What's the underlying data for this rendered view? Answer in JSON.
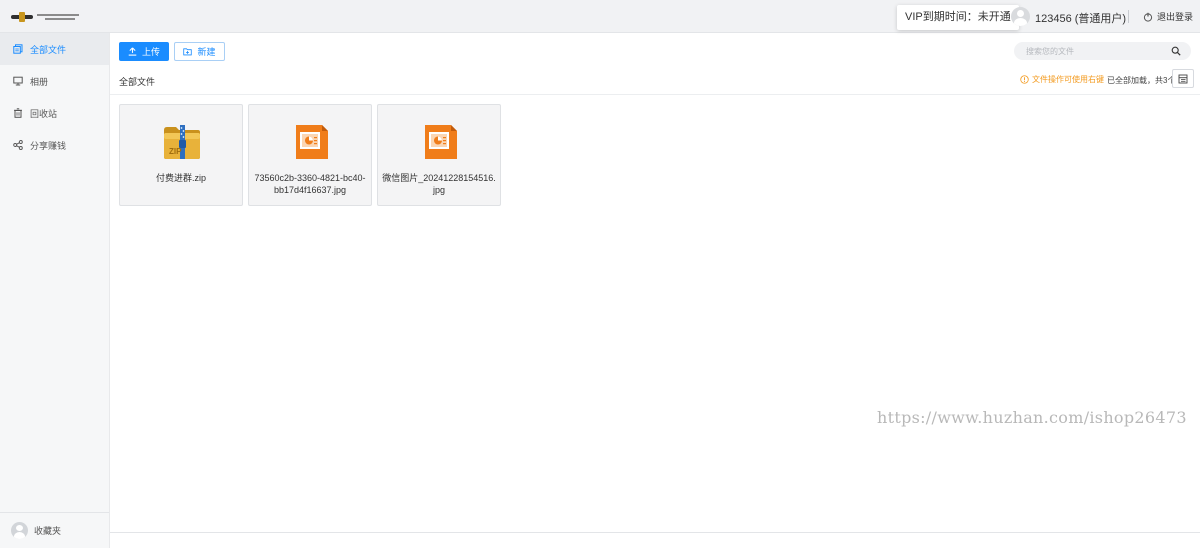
{
  "header": {
    "vip_tip": "VIP到期时间：未开通",
    "user_name": "123456 (普通用户)",
    "logout_label": "退出登录"
  },
  "sidebar": {
    "items": [
      {
        "label": "全部文件",
        "icon": "all-files-icon",
        "active": true
      },
      {
        "label": "相册",
        "icon": "monitor-icon",
        "active": false
      },
      {
        "label": "回收站",
        "icon": "trash-icon",
        "active": false
      },
      {
        "label": "分享赚钱",
        "icon": "share-icon",
        "active": false
      }
    ],
    "favorites_label": "收藏夹"
  },
  "toolbar": {
    "upload_label": "上传",
    "new_label": "新建",
    "search_placeholder": "搜索您的文件"
  },
  "main": {
    "breadcrumb": "全部文件",
    "tip": "文件操作可使用右键",
    "loaded_text": "已全部加载，共3个",
    "files": [
      {
        "name": "付费进群.zip",
        "icon": "zip-file-icon"
      },
      {
        "name": "73560c2b-3360-4821-bc40-bb17d4f16637.jpg",
        "icon": "image-file-icon"
      },
      {
        "name": "微信图片_20241228154516.jpg",
        "icon": "image-file-icon"
      }
    ]
  },
  "watermark": "https://www.huzhan.com/ishop26473",
  "colors": {
    "accent": "#1a8cff",
    "tip": "#f39b20",
    "zip_icon": "#e0aa2c",
    "image_icon": "#f07d1a"
  }
}
